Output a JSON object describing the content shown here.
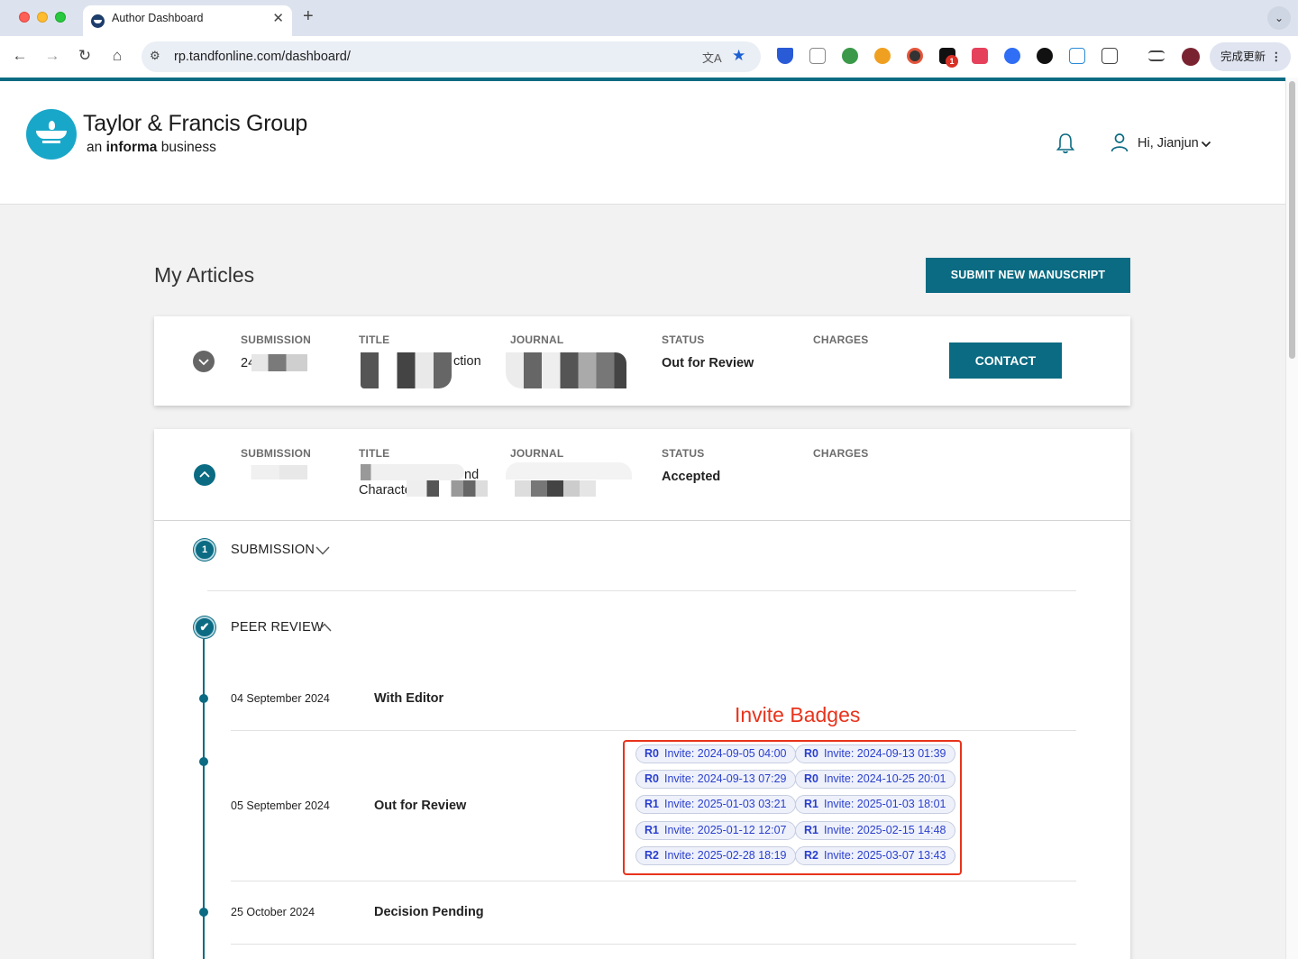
{
  "browser": {
    "tab_title": "Author Dashboard",
    "url": "rp.tandfonline.com/dashboard/",
    "extension_badge_count": "1",
    "update_button_label": "完成更新"
  },
  "header": {
    "logo_title": "Taylor & Francis Group",
    "logo_sub_prefix": "an ",
    "logo_sub_brand": "informa",
    "logo_sub_suffix": " business",
    "greeting": "Hi, Jianjun"
  },
  "page": {
    "title": "My Articles",
    "submit_button": "SUBMIT NEW MANUSCRIPT"
  },
  "columns": {
    "submission": "SUBMISSION",
    "title": "TITLE",
    "journal": "JOURNAL",
    "status": "STATUS",
    "charges": "CHARGES"
  },
  "articles": [
    {
      "submission_visible": "24",
      "title_line1_visible": "ction",
      "status": "Out for Review",
      "contact_button": "CONTACT"
    },
    {
      "title_line1_visible": "nd",
      "title_line2_visible": "Characte",
      "status": "Accepted"
    }
  ],
  "steps": {
    "submission": {
      "number": "1",
      "label": "SUBMISSION"
    },
    "peer_review": {
      "label": "PEER REVIEW"
    }
  },
  "timeline": [
    {
      "date": "04 September 2024",
      "status": "With Editor"
    },
    {
      "date": "05 September 2024",
      "status": "Out for Review"
    },
    {
      "date": "25 October 2024",
      "status": "Decision Pending"
    }
  ],
  "annotation": {
    "title": "Invite Badges"
  },
  "badges": [
    {
      "round": "R0",
      "text": "Invite: 2024-09-05 04:00"
    },
    {
      "round": "R0",
      "text": "Invite: 2024-09-13 01:39"
    },
    {
      "round": "R0",
      "text": "Invite: 2024-09-13 07:29"
    },
    {
      "round": "R0",
      "text": "Invite: 2024-10-25 20:01"
    },
    {
      "round": "R1",
      "text": "Invite: 2025-01-03 03:21"
    },
    {
      "round": "R1",
      "text": "Invite: 2025-01-03 18:01"
    },
    {
      "round": "R1",
      "text": "Invite: 2025-01-12 12:07"
    },
    {
      "round": "R1",
      "text": "Invite: 2025-02-15 14:48"
    },
    {
      "round": "R2",
      "text": "Invite: 2025-02-28 18:19"
    },
    {
      "round": "R2",
      "text": "Invite: 2025-03-07 13:43"
    }
  ],
  "colors": {
    "brand": "#0b6b82",
    "annotation": "#e8331c",
    "badge_text": "#2a3fcf"
  }
}
